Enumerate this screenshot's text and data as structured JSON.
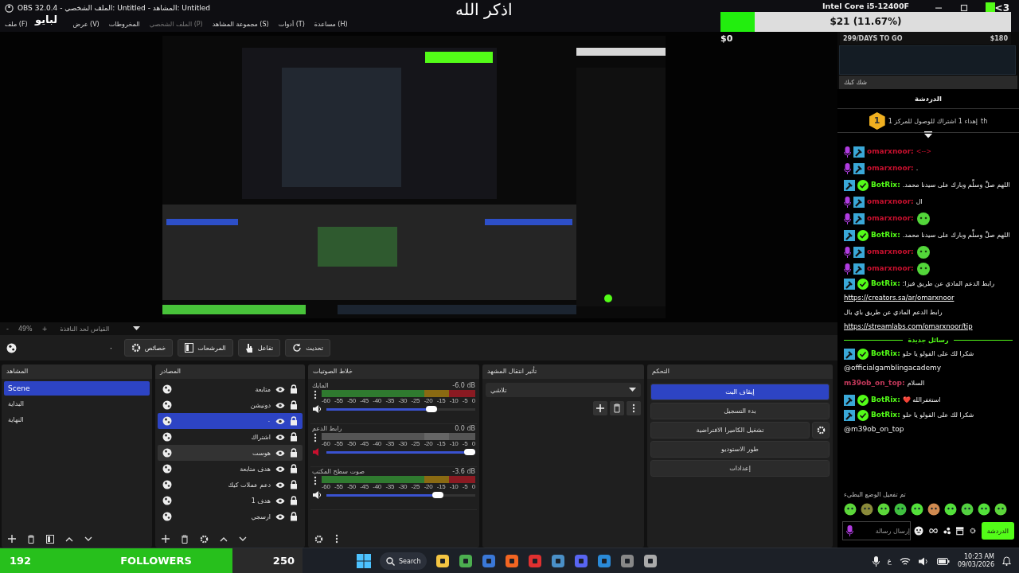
{
  "window": {
    "title": "OBS 32.0.4 - الملف الشخصي: Untitled - المشاهد: Untitled"
  },
  "overlay": {
    "logo": "لبايو",
    "dhikr": "اذكر الله"
  },
  "goal": {
    "title": "Intel Core i5-12400F",
    "bar_text": "$21 (11.67%)",
    "level": 0.1167,
    "start": "$0",
    "days": "299/DAYS TO GO",
    "target": "$180",
    "brand_text": "<3"
  },
  "menu": [
    {
      "label": "مساعدة (H)",
      "disabled": false
    },
    {
      "label": "أدوات (T)",
      "disabled": false
    },
    {
      "label": "مجموعة المشاهد (S)",
      "disabled": false
    },
    {
      "label": "الملف الشخصي (P)",
      "disabled": true
    },
    {
      "label": "المخروطات",
      "disabled": false
    },
    {
      "label": "عرض (V)",
      "disabled": false
    },
    {
      "label": "ملف (F)",
      "disabled": false
    }
  ],
  "zoom_bar": {
    "minus": "-",
    "zoom": "49%",
    "plus": "+",
    "mode": "القياس لحد النافذة"
  },
  "toolbar": {
    "source_name": "٠",
    "buttons": [
      {
        "kind": "refresh",
        "label": "تحديث"
      },
      {
        "kind": "hand",
        "label": "تفاعل"
      },
      {
        "kind": "filter",
        "label": "المرشحات"
      },
      {
        "kind": "gear",
        "label": "خصائص"
      }
    ]
  },
  "scenes": {
    "title": "المشاهد",
    "items": [
      {
        "label": "Scene",
        "selected": true
      },
      {
        "label": "البداية",
        "selected": false
      },
      {
        "label": "النهاية",
        "selected": false
      }
    ]
  },
  "sources": {
    "title": "المصادر",
    "items": [
      {
        "label": "متابعة",
        "selected": false,
        "hovered": false
      },
      {
        "label": "دونيشن",
        "selected": false,
        "hovered": false
      },
      {
        "label": "٠",
        "selected": true,
        "hovered": false
      },
      {
        "label": "اشتراك",
        "selected": false,
        "hovered": false
      },
      {
        "label": "هوست",
        "selected": false,
        "hovered": true
      },
      {
        "label": "هدف متابعة",
        "selected": false,
        "hovered": false
      },
      {
        "label": "دعم عملات كيك",
        "selected": false,
        "hovered": false
      },
      {
        "label": "هدف 1",
        "selected": false,
        "hovered": false
      },
      {
        "label": "ارسجي",
        "selected": false,
        "hovered": false
      }
    ]
  },
  "mixer": {
    "title": "خلاط الصوتيات",
    "channels": [
      {
        "name": "المايك",
        "reading": "-6.0 dB",
        "muted": false,
        "level": 0.72,
        "ticks": [
          "0",
          "-5",
          "-10",
          "-15",
          "-20",
          "-25",
          "-30",
          "-35",
          "-40",
          "-45",
          "-50",
          "-55",
          "-60"
        ]
      },
      {
        "name": "رابط الدعم",
        "reading": "0.0 dB",
        "muted": true,
        "level": 1.0,
        "ticks": [
          "0",
          "-5",
          "-10",
          "-15",
          "-20",
          "-25",
          "-30",
          "-35",
          "-40",
          "-45",
          "-50",
          "-55",
          "-60"
        ]
      },
      {
        "name": "صوت سطح المكتب",
        "reading": "-3.6 dB",
        "muted": false,
        "level": 0.77,
        "ticks": [
          "0",
          "-5",
          "-10",
          "-15",
          "-20",
          "-25",
          "-30",
          "-35",
          "-40",
          "-45",
          "-50",
          "-55",
          "-60"
        ]
      }
    ]
  },
  "transitions": {
    "title": "تأثير انتقال المشهد",
    "value": "تلاشي"
  },
  "controls": {
    "title": "التحكم",
    "buttons": [
      {
        "label": "إيقاف البث",
        "active": true,
        "gear": false
      },
      {
        "label": "بدء التسجيل",
        "active": false,
        "gear": false
      },
      {
        "label": "تشغيل الكاميرا الافتراضية",
        "active": false,
        "gear": true
      },
      {
        "label": "طور الاستوديو",
        "active": false,
        "gear": false
      },
      {
        "label": "إعدادات",
        "active": false,
        "gear": false
      }
    ]
  },
  "side": {
    "tab": "شك كبك"
  },
  "chat": {
    "title": "الدردشة",
    "pinned": {
      "rank": "1",
      "text": "إهداء 1 اشتراك للوصول للمركز 1",
      "suffix": "th"
    },
    "messages": [
      {
        "kind": "text",
        "mic_badge": true,
        "mod_badge": true,
        "user": "omarxnoor:",
        "color": "#c8102e",
        "text": "<-->",
        "alert": true
      },
      {
        "kind": "text",
        "mic_badge": true,
        "mod_badge": true,
        "user": "omarxnoor:",
        "color": "#c8102e",
        "text": "."
      },
      {
        "kind": "text",
        "mod_badge": true,
        "verified_badge": true,
        "user": "BotRix:",
        "color": "#53fc18",
        "text": "اللهم صلِّ وسلِّم وبارك على سيدنا محمد."
      },
      {
        "kind": "text",
        "mic_badge": true,
        "mod_badge": true,
        "user": "omarxnoor:",
        "color": "#c8102e",
        "text": "ال"
      },
      {
        "kind": "emote",
        "mic_badge": true,
        "mod_badge": true,
        "user": "omarxnoor:",
        "color": "#c8102e"
      },
      {
        "kind": "text",
        "mod_badge": true,
        "verified_badge": true,
        "user": "BotRix:",
        "color": "#53fc18",
        "text": "اللهم صلِّ وسلِّم وبارك على سيدنا محمد."
      },
      {
        "kind": "emote",
        "mic_badge": true,
        "mod_badge": true,
        "user": "omarxnoor:",
        "color": "#c8102e"
      },
      {
        "kind": "emote",
        "mic_badge": true,
        "mod_badge": true,
        "user": "omarxnoor:",
        "color": "#c8102e"
      },
      {
        "kind": "links",
        "mod_badge": true,
        "verified_badge": true,
        "user": "BotRix:",
        "color": "#53fc18",
        "parts": [
          {
            "kind": "text",
            "text": "رابط الدعم المادي عن طريق فيزا:"
          },
          {
            "kind": "link",
            "text": "https://creators.sa/ar/omarxnoor"
          },
          {
            "kind": "text",
            "text": "رابط الدعم المادي عن طريق باي بال"
          },
          {
            "kind": "link",
            "text": "https://streamlabs.com/omarxnoor/tip"
          }
        ]
      },
      {
        "kind": "divider",
        "text": "رسائل جديدة"
      },
      {
        "kind": "text",
        "mod_badge": true,
        "verified_badge": true,
        "user": "BotRix:",
        "color": "#53fc18",
        "text": "شكرا لك على الفولو يا حلو",
        "mention": "@officialgamblingacademy"
      },
      {
        "kind": "text",
        "user": "m39ob_on_top:",
        "color": "#c2385a",
        "text": "السلام"
      },
      {
        "kind": "text",
        "mod_badge": true,
        "verified_badge": true,
        "user": "BotRix:",
        "color": "#53fc18",
        "text": "استغفرالله ❤️"
      },
      {
        "kind": "text",
        "mod_badge": true,
        "verified_badge": true,
        "user": "BotRix:",
        "color": "#53fc18",
        "text": "شكرا لك على الفولو يا حلو",
        "mention": "@m39ob_on_top"
      }
    ],
    "slow_mode": "تم تفعيل الوضع البطيء",
    "placeholder": "إرسال رسالة",
    "send": "الدردشة"
  },
  "followers": {
    "count": "192",
    "label": "FOLLOWERS",
    "goal": "250",
    "level": 0.768
  },
  "taskbar": {
    "search": "Search",
    "lang": "ع",
    "time": "10:23 AM",
    "date": "09/03/2026"
  }
}
